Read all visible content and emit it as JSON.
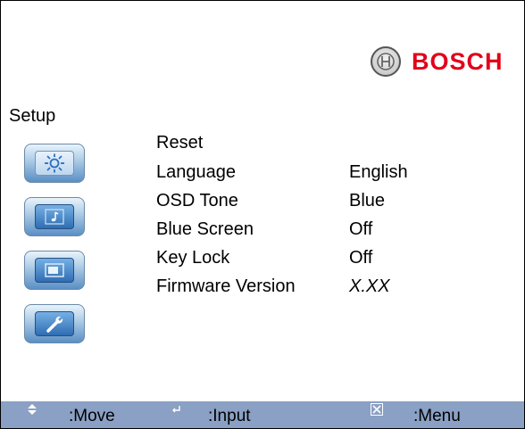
{
  "brand": {
    "name": "BOSCH",
    "logo_icon": "bosch-armature-icon"
  },
  "screen": {
    "title": "Setup"
  },
  "side_icons": [
    {
      "name": "brightness-icon",
      "selected": true
    },
    {
      "name": "audio-note-icon",
      "selected": false
    },
    {
      "name": "screen-display-icon",
      "selected": false
    },
    {
      "name": "wrench-icon",
      "selected": false
    }
  ],
  "menu": {
    "items": [
      {
        "label": "Reset",
        "value": ""
      },
      {
        "label": "Language",
        "value": "English"
      },
      {
        "label": "OSD Tone",
        "value": "Blue"
      },
      {
        "label": "Blue Screen",
        "value": "Off"
      },
      {
        "label": "Key Lock",
        "value": "Off"
      },
      {
        "label": "Firmware Version",
        "value": "X.XX"
      }
    ]
  },
  "footer": {
    "move": {
      "icon": "up-down-arrows-icon",
      "label": ":Move"
    },
    "input": {
      "icon": "enter-icon",
      "label": ":Input"
    },
    "menu": {
      "icon": "close-x-icon",
      "label": ":Menu"
    }
  },
  "colors": {
    "footer_bg": "#8aa0c4",
    "brand_red": "#e2001a",
    "icon_blue": "#2f6db3"
  }
}
